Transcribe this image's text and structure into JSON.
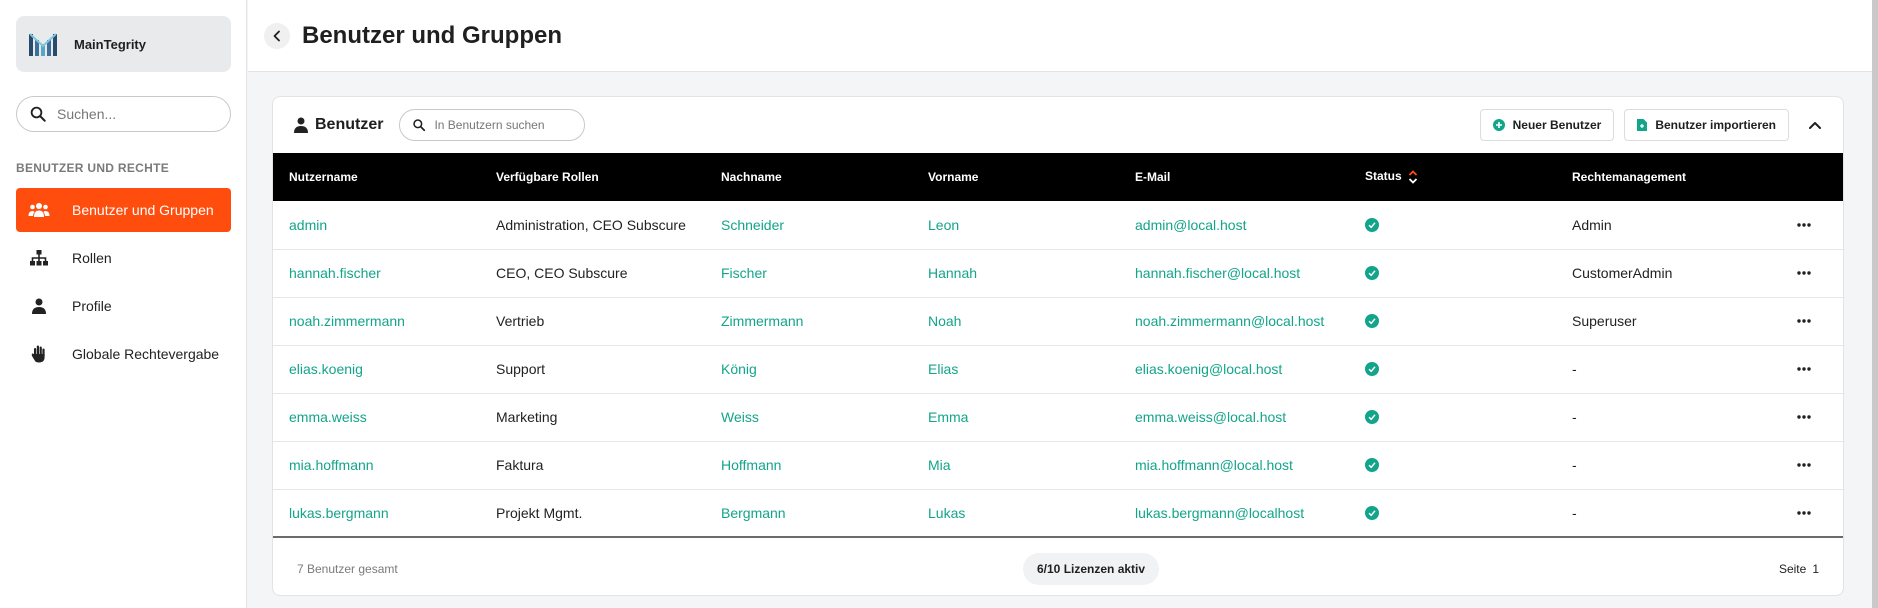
{
  "brand": {
    "name": "MainTegrity"
  },
  "sidebar": {
    "search_placeholder": "Suchen...",
    "section_title": "BENUTZER UND RECHTE",
    "items": [
      {
        "label": "Benutzer und Gruppen",
        "icon": "users-icon",
        "active": true
      },
      {
        "label": "Rollen",
        "icon": "hierarchy-icon"
      },
      {
        "label": "Profile",
        "icon": "person-icon"
      },
      {
        "label": "Globale Rechtevergabe",
        "icon": "hand-icon"
      }
    ]
  },
  "header": {
    "title": "Benutzer und Gruppen"
  },
  "card": {
    "title": "Benutzer",
    "search_placeholder": "In Benutzern suchen",
    "new_user_label": "Neuer Benutzer",
    "import_label": "Benutzer importieren"
  },
  "table": {
    "columns": [
      "Nutzername",
      "Verfügbare Rollen",
      "Nachname",
      "Vorname",
      "E-Mail",
      "Status",
      "Rechtemanagement"
    ],
    "rows": [
      {
        "username": "admin",
        "roles": "Administration, CEO Subscure",
        "lastname": "Schneider",
        "firstname": "Leon",
        "email": "admin@local.host",
        "rights": "Admin"
      },
      {
        "username": "hannah.fischer",
        "roles": "CEO, CEO Subscure",
        "lastname": "Fischer",
        "firstname": "Hannah",
        "email": "hannah.fischer@local.host",
        "rights": "CustomerAdmin"
      },
      {
        "username": "noah.zimmermann",
        "roles": "Vertrieb",
        "lastname": "Zimmermann",
        "firstname": "Noah",
        "email": "noah.zimmermann@local.host",
        "rights": "Superuser"
      },
      {
        "username": "elias.koenig",
        "roles": "Support",
        "lastname": "König",
        "firstname": "Elias",
        "email": "elias.koenig@local.host",
        "rights": "-"
      },
      {
        "username": "emma.weiss",
        "roles": "Marketing",
        "lastname": "Weiss",
        "firstname": "Emma",
        "email": "emma.weiss@local.host",
        "rights": "-"
      },
      {
        "username": "mia.hoffmann",
        "roles": "Faktura",
        "lastname": "Hoffmann",
        "firstname": "Mia",
        "email": "mia.hoffmann@local.host",
        "rights": "-"
      },
      {
        "username": "lukas.bergmann",
        "roles": "Projekt Mgmt.",
        "lastname": "Bergmann",
        "firstname": "Lukas",
        "email": "lukas.bergmann@localhost",
        "rights": "-"
      }
    ]
  },
  "footer": {
    "total": "7 Benutzer gesamt",
    "licenses": "6/10 Lizenzen aktiv",
    "page_label": "Seite",
    "page_number": "1"
  },
  "colors": {
    "accent": "#ff4d0d",
    "link": "#12a58a",
    "header_bg": "#000000"
  }
}
